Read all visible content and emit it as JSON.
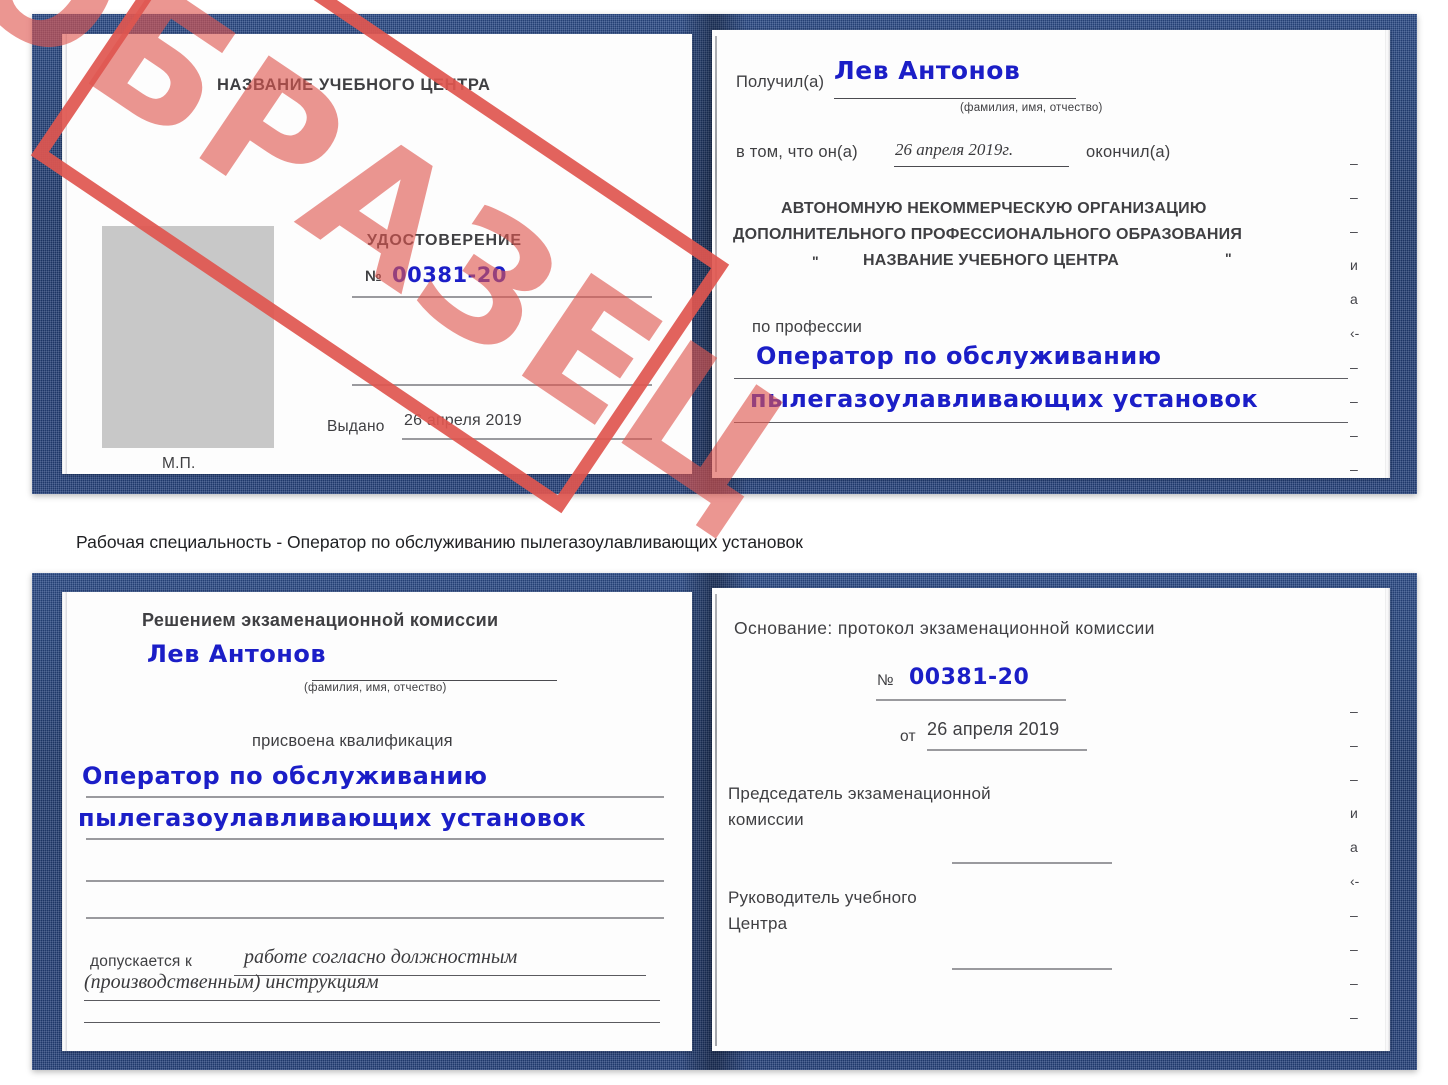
{
  "caption": "Рабочая специальность - Оператор по обслуживанию пылегазоулавливающих установок",
  "colors": {
    "cover_blue": "#1f3a6e",
    "stamp_red": "#e0564f",
    "handwriting_blue": "#1b1ec7",
    "photo_placeholder_gray": "#c8c8c8",
    "rule_gray": "#9a9a9e"
  },
  "stamp": {
    "label": "ОБРАЗЕЦ"
  },
  "certificate_front": {
    "left_page": {
      "center_name": "НАЗВАНИЕ УЧЕБНОГО ЦЕНТРА",
      "doc_type": "УДОСТОВЕРЕНИЕ",
      "number_label": "№",
      "number_value": "00381-20",
      "issued_label": "Выдано",
      "issued_value": "26 апреля 2019",
      "seal_label": "М.П."
    },
    "right_page": {
      "received_label": "Получил(а)",
      "received_value": "Лев Антонов",
      "fio_hint": "(фамилия, имя, отчество)",
      "in_that_label": "в том, что он(а)",
      "completion_date": "26 апреля 2019г.",
      "finished_label": "окончил(а)",
      "org_line1": "АВТОНОМНУЮ НЕКОММЕРЧЕСКУЮ ОРГАНИЗАЦИЮ",
      "org_line2": "ДОПОЛНИТЕЛЬНОГО ПРОФЕССИОНАЛЬНОГО ОБРАЗОВАНИЯ",
      "org_quote_open": "\"",
      "org_name": "НАЗВАНИЕ УЧЕБНОГО ЦЕНТРА",
      "org_quote_close": "\"",
      "profession_label": "по профессии",
      "profession_line1": "Оператор по обслуживанию",
      "profession_line2": "пылегазоулавливающих установок",
      "margin_glyphs": [
        "–",
        "–",
        "–",
        "и",
        "а",
        "‹-",
        "–",
        "–",
        "–",
        "–"
      ]
    }
  },
  "certificate_back": {
    "left_page": {
      "decision_title": "Решением экзаменационной комиссии",
      "name_value": "Лев Антонов",
      "fio_hint": "(фамилия, имя, отчество)",
      "qualification_label": "присвоена квалификация",
      "qualification_line1": "Оператор по обслуживанию",
      "qualification_line2": "пылегазоулавливающих установок",
      "admitted_label": "допускается к",
      "admitted_value_line1": "работе согласно должностным",
      "admitted_value_line2": "(производственным) инструкциям"
    },
    "right_page": {
      "basis_label": "Основание: протокол экзаменационной комиссии",
      "number_label": "№",
      "number_value": "00381-20",
      "date_label": "от",
      "date_value": "26 апреля 2019",
      "chairman_line1": "Председатель экзаменационной",
      "chairman_line2": "комиссии",
      "director_line1": "Руководитель учебного",
      "director_line2": "Центра",
      "margin_glyphs": [
        "–",
        "–",
        "–",
        "и",
        "а",
        "‹-",
        "–",
        "–",
        "–",
        "–"
      ]
    }
  }
}
